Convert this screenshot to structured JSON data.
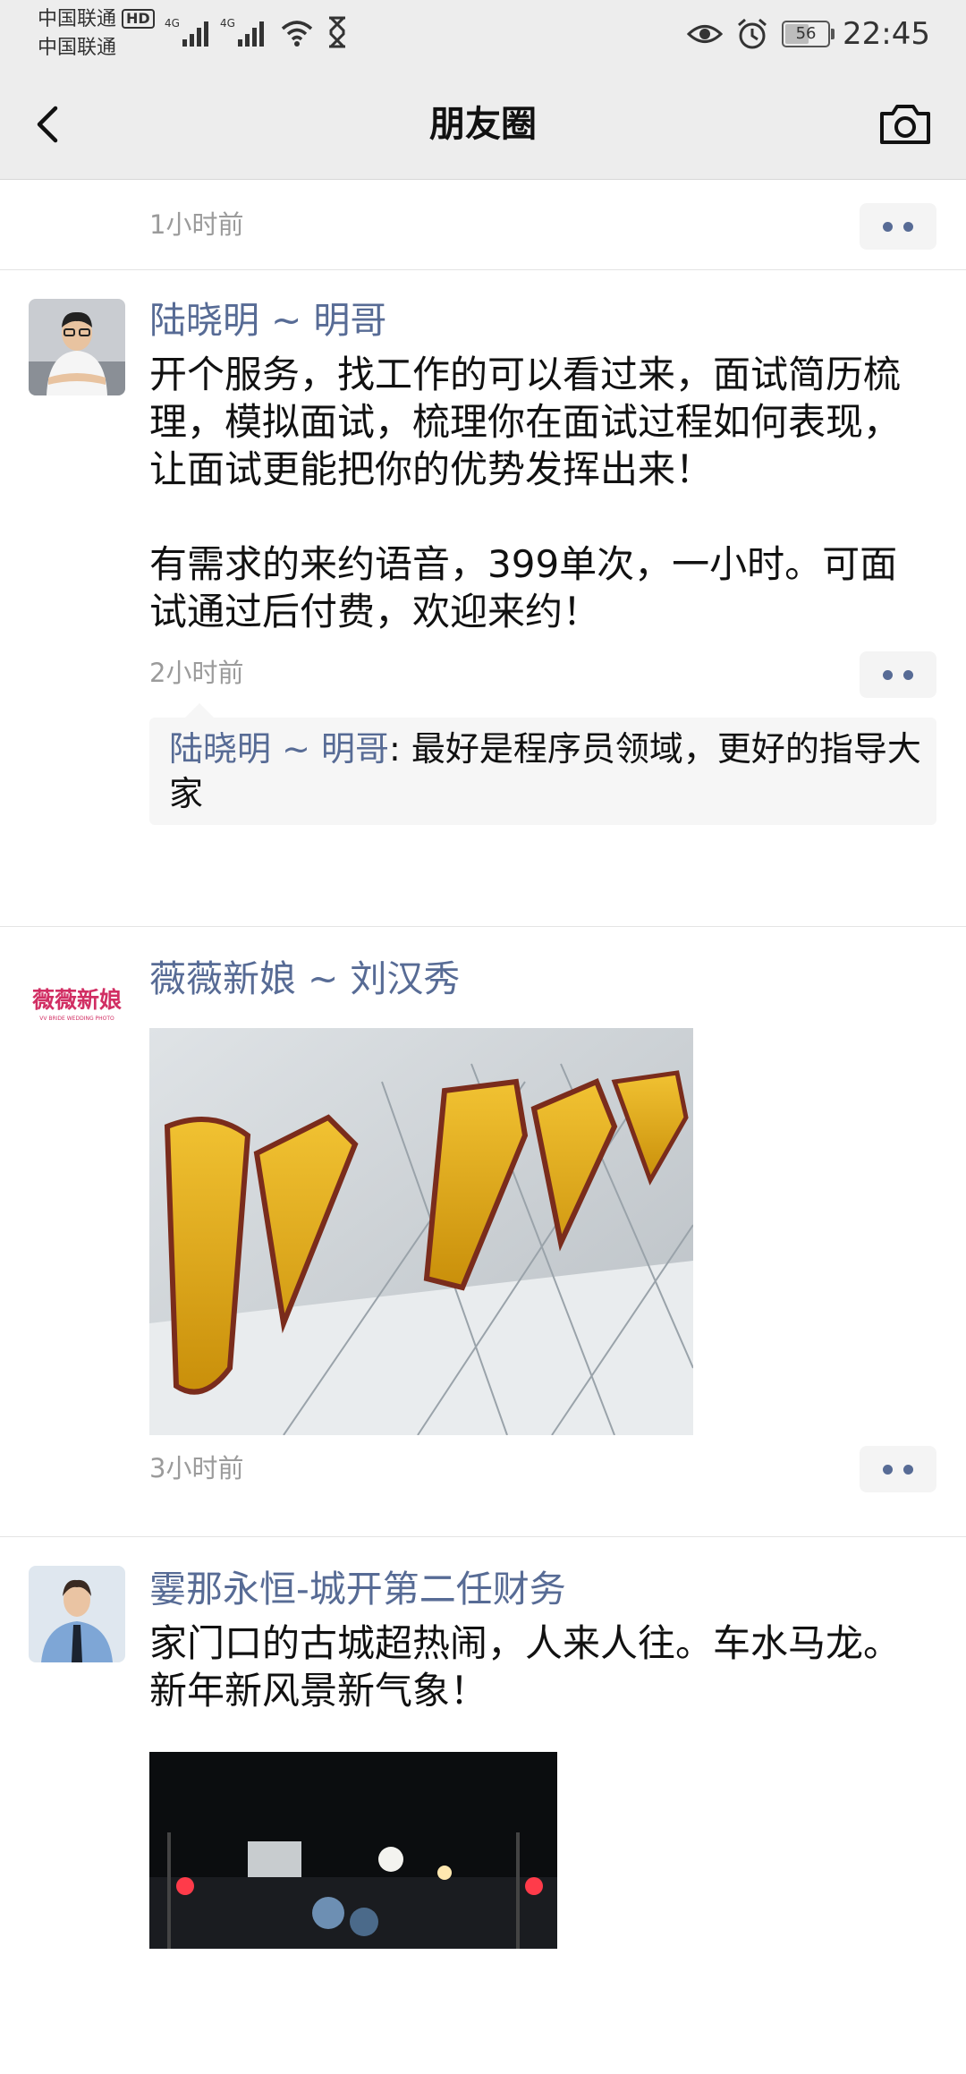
{
  "status_bar": {
    "carrier_1": "中国联通",
    "carrier_2": "中国联通",
    "hd_badge": "HD",
    "network_1": "4G",
    "network_2": "4G",
    "battery_percent": 56,
    "battery_label": "56",
    "time": "22:45",
    "icons": [
      "signal-icon",
      "wifi-icon",
      "hourglass-icon",
      "eye-icon",
      "alarm-icon",
      "battery-icon"
    ]
  },
  "nav": {
    "title": "朋友圈",
    "back_icon": "chevron-left-icon",
    "camera_icon": "camera-icon"
  },
  "posts": [
    {
      "time": "1小时前"
    },
    {
      "username": "陆晓明 ~ 明哥",
      "content": "开个服务，找工作的可以看过来，面试简历梳理，模拟面试，梳理你在面试过程如何表现，让面试更能把你的优势发挥出来！\n\n有需求的来约语音，399单次，一小时。可面试通过后付费，欢迎来约！",
      "time": "2小时前",
      "comments": [
        {
          "author": "陆晓明 ~ 明哥",
          "text": ": 最好是程序员领域，更好的指导大家"
        }
      ]
    },
    {
      "username": "薇薇新娘 ~ 刘汉秀",
      "avatar_logo": "薇薇新娘",
      "avatar_logo_small": "VV BRIDE WEDDING PHOTO",
      "time": "3小时前"
    },
    {
      "username": "霎那永恒-城开第二任财务",
      "content": "家门口的古城超热闹，人来人往。车水马龙。新年新风景新气象！"
    }
  ],
  "colors": {
    "link_blue": "#576b95",
    "bar_bg": "#ededed",
    "time_gray": "#9b9b9b"
  }
}
